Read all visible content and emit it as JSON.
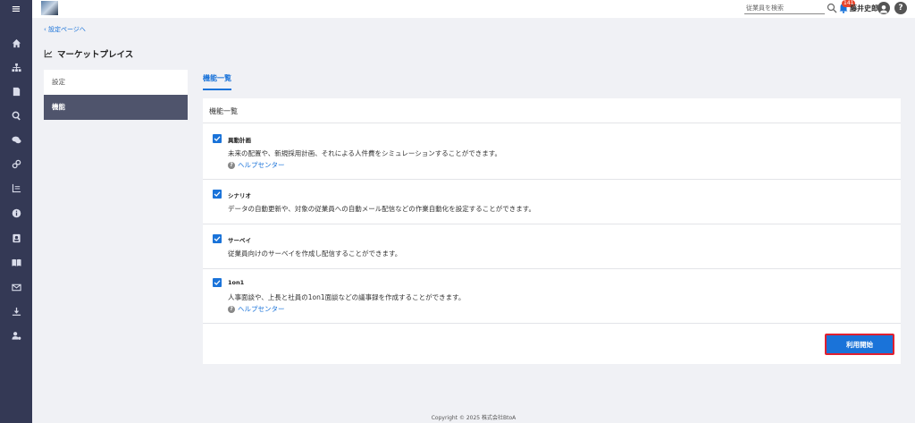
{
  "topbar": {
    "search_placeholder": "従業員を検索",
    "notification_count": "141",
    "user_name": "藤井史郎"
  },
  "nav": {
    "back_link": "設定ページへ",
    "page_title": "マーケットプレイス"
  },
  "sidebar": {
    "items": [
      {
        "label": "設定",
        "active": false
      },
      {
        "label": "機能",
        "active": true
      }
    ]
  },
  "tabs": [
    {
      "label": "機能一覧",
      "active": true
    }
  ],
  "card": {
    "title": "機能一覧",
    "features": [
      {
        "name": "異動計画",
        "checked": true,
        "description": "未来の配置や、新規採用計画、それによる人件費をシミュレーションすることができます。",
        "help": "ヘルプセンター"
      },
      {
        "name": "シナリオ",
        "checked": true,
        "description": "データの自動更新や、対象の従業員への自動メール配信などの作業自動化を設定することができます。",
        "help": ""
      },
      {
        "name": "サーベイ",
        "checked": true,
        "description": "従業員向けのサーベイを作成し配信することができます。",
        "help": ""
      },
      {
        "name": "1on1",
        "checked": true,
        "description": "人事面談や、上長と社員の1on1面談などの議事録を作成することができます。",
        "help": "ヘルプセンター"
      }
    ],
    "start_button": "利用開始"
  },
  "footer": {
    "copyright": "Copyright © 2025 株式会社BtoA"
  },
  "colors": {
    "rail": "#343955",
    "accent": "#1a73d9",
    "active_sidebar": "#4f546c",
    "highlight_border": "#e02030"
  },
  "icons": [
    "menu-icon",
    "home-icon",
    "org-chart-icon",
    "document-icon",
    "search-icon",
    "chat-icon",
    "link-icon",
    "chart-icon",
    "info-icon",
    "contact-card-icon",
    "book-icon",
    "mail-icon",
    "download-icon",
    "user-settings-icon",
    "bell-icon",
    "user-icon",
    "help-icon",
    "check-icon"
  ]
}
